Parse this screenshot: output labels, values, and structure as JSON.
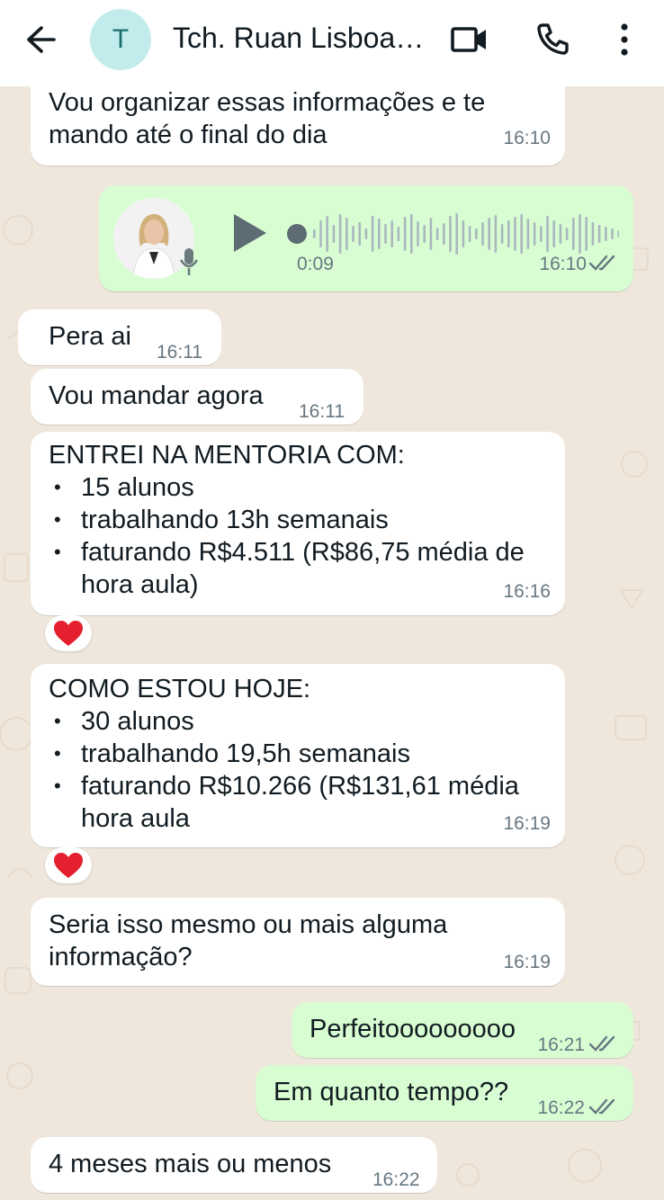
{
  "header": {
    "contact_name": "Tch. Ruan Lisboa…",
    "avatar_initial": "T"
  },
  "messages": [
    {
      "id": "m1",
      "direction": "in",
      "text_lines": [
        "Vou organizar essas informações e te",
        "mando até o final do dia"
      ],
      "time": "16:10"
    },
    {
      "id": "m2",
      "direction": "out",
      "type": "voice",
      "duration": "0:09",
      "time": "16:10",
      "status": "read"
    },
    {
      "id": "m3",
      "direction": "in",
      "text": "Pera ai",
      "time": "16:11"
    },
    {
      "id": "m4",
      "direction": "in",
      "text": "Vou mandar agora",
      "time": "16:11"
    },
    {
      "id": "m5",
      "direction": "in",
      "heading": "ENTREI NA MENTORIA COM:",
      "items": [
        "15 alunos",
        "trabalhando 13h semanais",
        "faturando R$4.511 (R$86,75 média de"
      ],
      "continuation": "hora aula)",
      "time": "16:16",
      "reaction": "heart"
    },
    {
      "id": "m6",
      "direction": "in",
      "heading": "COMO ESTOU HOJE:",
      "items": [
        "30 alunos",
        "trabalhando 19,5h semanais",
        "faturando R$10.266 (R$131,61 média"
      ],
      "continuation": "hora aula",
      "time": "16:19",
      "reaction": "heart"
    },
    {
      "id": "m7",
      "direction": "in",
      "text_lines": [
        "Seria isso mesmo ou mais alguma",
        "informação?"
      ],
      "time": "16:19"
    },
    {
      "id": "m8",
      "direction": "out",
      "text": "Perfeitooooooooo",
      "time": "16:21",
      "status": "read"
    },
    {
      "id": "m9",
      "direction": "out",
      "text": "Em quanto tempo??",
      "time": "16:22",
      "status": "read"
    },
    {
      "id": "m10",
      "direction": "in",
      "text": "4 meses mais ou menos",
      "time": "16:22"
    }
  ],
  "colors": {
    "incoming_bubble": "#ffffff",
    "outgoing_bubble": "#d9fdd3",
    "chat_background": "#efe7dc",
    "read_ticks": "#667781",
    "reaction_heart": "#e5202e"
  }
}
